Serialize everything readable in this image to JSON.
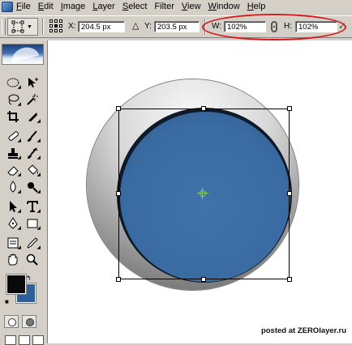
{
  "menu": {
    "items": [
      {
        "underline": "F",
        "rest": "ile"
      },
      {
        "underline": "E",
        "rest": "dit"
      },
      {
        "underline": "I",
        "rest": "mage"
      },
      {
        "underline": "L",
        "rest": "ayer"
      },
      {
        "underline": "S",
        "rest": "elect"
      },
      {
        "underline": "",
        "rest": "Filter"
      },
      {
        "underline": "V",
        "rest": "iew"
      },
      {
        "underline": "W",
        "rest": "indow"
      },
      {
        "underline": "H",
        "rest": "elp"
      }
    ]
  },
  "options_bar": {
    "x_label": "X:",
    "x_value": "204.5 px",
    "y_label": "Y:",
    "y_value": "203.5 px",
    "w_label": "W:",
    "w_value": "102%",
    "h_label": "H:",
    "h_value": "102%"
  },
  "colors": {
    "foreground": "#0a0a0a",
    "background": "#2f5f99",
    "highlight_ellipse": "#d7191e",
    "canvas_disc": "#3a6ca3"
  },
  "watermark": "posted at ZEROlayer.ru"
}
